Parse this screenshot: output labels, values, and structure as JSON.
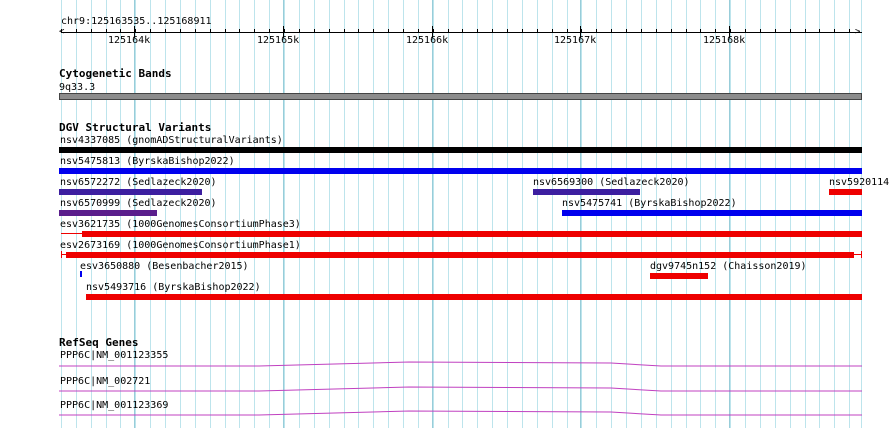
{
  "ruler": {
    "location": "chr9:125163535..125168911",
    "ticks": [
      "125164k",
      "125165k",
      "125166k",
      "125167k",
      "125168k"
    ]
  },
  "cytogenetic": {
    "title": "Cytogenetic Bands",
    "band": "9q33.3"
  },
  "dgv": {
    "title": "DGV Structural Variants",
    "features": [
      {
        "label": "nsv4337085 (gnomADStructuralVariants)",
        "color": "#000000"
      },
      {
        "label": "nsv5475813 (ByrskaBishop2022)",
        "color": "#0000ee"
      },
      {
        "label": "nsv6572272 (Sedlazeck2020)",
        "color": "#3c1ea0"
      },
      {
        "label": "nsv6569300 (Sedlazeck2020)",
        "color": "#3c1ea0"
      },
      {
        "label": "nsv5920114",
        "color": "#ee0000"
      },
      {
        "label": "nsv6570999 (Sedlazeck2020)",
        "color": "#5a1e8c"
      },
      {
        "label": "nsv5475741 (ByrskaBishop2022)",
        "color": "#0000ee"
      },
      {
        "label": "esv3621735 (1000GenomesConsortiumPhase3)",
        "color": "#ee0000"
      },
      {
        "label": "esv2673169 (1000GenomesConsortiumPhase1)",
        "color": "#ee0000"
      },
      {
        "label": "esv3650880 (Besenbacher2015)",
        "color": "#0000ee"
      },
      {
        "label": "dgv9745n152 (Chaisson2019)",
        "color": "#ee0000"
      },
      {
        "label": "nsv5493716 (ByrskaBishop2022)",
        "color": "#ee0000"
      }
    ]
  },
  "refseq": {
    "title": "RefSeq Genes",
    "genes": [
      {
        "label": "PPP6C|NM_001123355",
        "color": "#c040c0"
      },
      {
        "label": "PPP6C|NM_002721",
        "color": "#c040c0"
      },
      {
        "label": "PPP6C|NM_001123369",
        "color": "#c040c0"
      }
    ]
  }
}
